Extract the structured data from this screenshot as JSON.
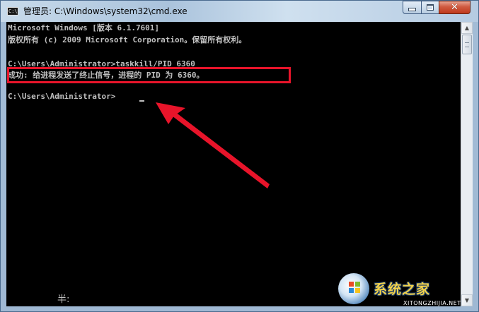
{
  "window": {
    "title": "管理员: C:\\Windows\\system32\\cmd.exe",
    "icon_label": "C:\\"
  },
  "controls": {
    "minimize_icon": "minimize-icon",
    "maximize_icon": "maximize-icon",
    "close_icon": "close-icon",
    "close_glyph": "✕"
  },
  "console": {
    "lines": [
      "Microsoft Windows [版本 6.1.7601]",
      "版权所有 (c) 2009 Microsoft Corporation。保留所有权利。",
      "",
      "C:\\Users\\Administrator>taskkill/PID 6360",
      "成功: 给进程发送了终止信号，进程的 PID 为 6360。",
      "",
      "C:\\Users\\Administrator>"
    ],
    "ime_status": "半:",
    "text_color": "#c0c0c0",
    "background": "#000000"
  },
  "annotation": {
    "highlight_color": "#e8142a",
    "arrow_color": "#e8142a"
  },
  "scrollbar": {
    "up_glyph": "▲",
    "down_glyph": "▼"
  },
  "watermark": {
    "title": "系统之家",
    "subtitle": "XITONGZHIJIA.NET"
  }
}
